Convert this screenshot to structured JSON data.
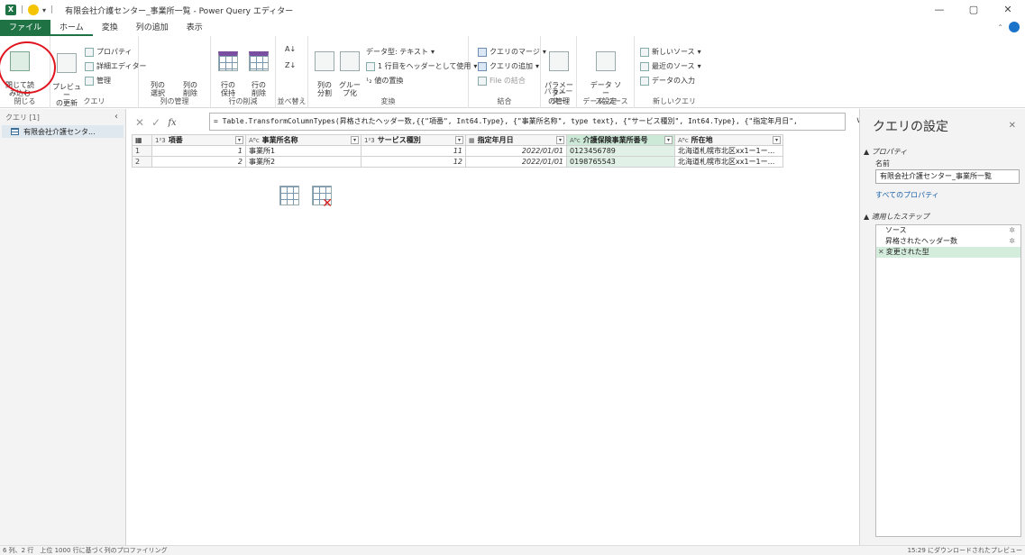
{
  "window": {
    "title": "有限会社介護センター_事業所一覧 - Power Query エディター",
    "excel_badge": "X",
    "caret": "▾",
    "controls": {
      "minimize": "—",
      "restore": "▢",
      "close": "✕"
    }
  },
  "menu": {
    "file": "ファイル",
    "tabs": [
      "ホーム",
      "変換",
      "列の追加",
      "表示"
    ]
  },
  "ribbon": {
    "close_load": "閉じて読\nみ込む",
    "close_group": "閉じる",
    "preview_refresh": "プレビュー\nの更新",
    "properties": "プロパティ",
    "advanced_editor": "詳細エディター",
    "manage": "管理",
    "query_group": "クエリ",
    "choose_columns": "列の\n選択",
    "remove_columns": "列の\n削除",
    "manage_columns_group": "列の管理",
    "keep_rows": "行の\n保持",
    "remove_rows": "行の\n削除",
    "reduce_rows_group": "行の削減",
    "sort_group": "並べ替え",
    "split_column": "列の\n分割",
    "group_by": "グルー\nプ化",
    "data_type": "データ型: テキスト",
    "use_first_row": "1 行目をヘッダーとして使用",
    "replace_values": "値の置換",
    "transform_group": "変換",
    "merge_queries": "クエリのマージ",
    "append_queries": "クエリの追加",
    "combine_files": "File の結合",
    "combine_group": "結合",
    "manage_params": "パラメーター\nの管理",
    "params_group": "パラメーター",
    "datasource_settings": "データ ソー\nス設定",
    "datasource_group": "データ ソース",
    "new_source": "新しいソース",
    "recent_sources": "最近のソース",
    "enter_data": "データの入力",
    "new_query_group": "新しいクエリ"
  },
  "queries_pane": {
    "header": "クエリ [1]",
    "items": [
      "有限会社介護センタ..."
    ]
  },
  "formula_bar": {
    "formula": "= Table.TransformColumnTypes(昇格されたヘッダー数,{{\"項番\", Int64.Type}, {\"事業所名称\", type text}, {\"サービス種別\", Int64.Type}, {\"指定年月日\","
  },
  "grid": {
    "columns": [
      {
        "type": "1²3",
        "name": "項番"
      },
      {
        "type": "Aᴮc",
        "name": "事業所名称"
      },
      {
        "type": "1²3",
        "name": "サービス種別"
      },
      {
        "type": "▦",
        "name": "指定年月日"
      },
      {
        "type": "Aᴮc",
        "name": "介護保険事業所番号"
      },
      {
        "type": "Aᴮc",
        "name": "所在地"
      }
    ],
    "rows": [
      [
        "1",
        "1",
        "事業所1",
        "11",
        "2022/01/01",
        "0123456789",
        "北海道札幌市北区xx1ー1ー..."
      ],
      [
        "2",
        "2",
        "事業所2",
        "12",
        "2022/01/01",
        "0198765543",
        "北海道札幌市北区xx1ー1ー..."
      ]
    ]
  },
  "settings_pane": {
    "title": "クエリの設定",
    "properties_header": "▲ プロパティ",
    "name_label": "名前",
    "name_value": "有限会社介護センター_事業所一覧",
    "all_properties": "すべてのプロパティ",
    "applied_steps_header": "▲ 適用したステップ",
    "steps": [
      "ソース",
      "昇格されたヘッダー数",
      "変更された型"
    ]
  },
  "status": {
    "left": "6 列、2 行　上位 1000 行に基づく列のプロファイリング",
    "right": "15:29 にダウンロードされたプレビュー"
  }
}
